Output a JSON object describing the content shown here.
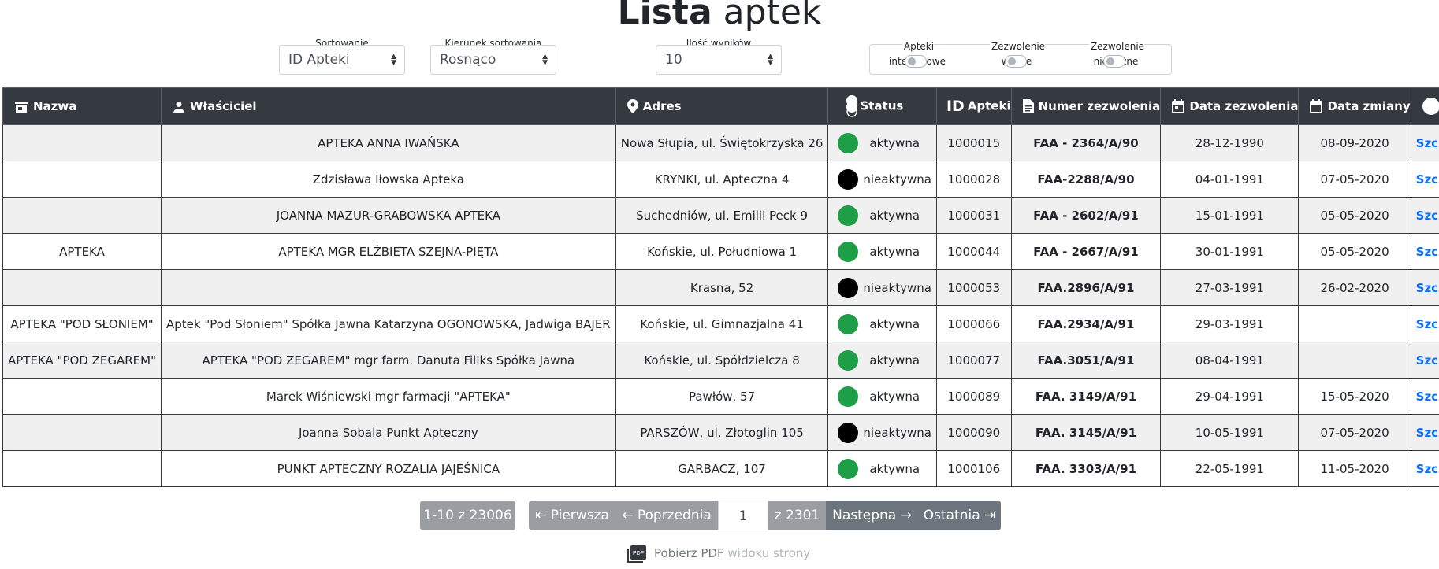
{
  "title": {
    "bold": "Lista",
    "light": "aptek"
  },
  "controls": {
    "sort": {
      "label": "Sortowanie",
      "value": "ID Apteki"
    },
    "direction": {
      "label": "Kierunek sortowania",
      "value": "Rosnąco"
    },
    "count": {
      "label": "Ilość wyników",
      "value": "10"
    }
  },
  "toggles": [
    {
      "label": "Apteki internetowe",
      "on": false
    },
    {
      "label": "Zezwolenie ważne",
      "on": false
    },
    {
      "label": "Zezwolenie nieważne",
      "on": false
    }
  ],
  "columns": [
    "Nazwa",
    "Właściciel",
    "Adres",
    "Status",
    "Apteki",
    "Numer zezwolenia",
    "Data zezwolenia",
    "Data zmiany",
    ""
  ],
  "id_prefix": "ID",
  "status_colors": {
    "aktywna": "#1e9e47",
    "nieaktywna": "#000000"
  },
  "rows": [
    {
      "nazwa": "",
      "wlasciciel": "APTEKA ANNA IWAŃSKA",
      "adres": "Nowa Słupia, ul. Świętokrzyska 26",
      "status": "aktywna",
      "id": "1000015",
      "numer": "FAA - 2364/A/90",
      "data_zezw": "28-12-1990",
      "data_zm": "08-09-2020",
      "link": "Szczegóły"
    },
    {
      "nazwa": "",
      "wlasciciel": "Zdzisława Iłowska Apteka",
      "adres": "KRYNKI, ul. Apteczna 4",
      "status": "nieaktywna",
      "id": "1000028",
      "numer": "FAA-2288/A/90",
      "data_zezw": "04-01-1991",
      "data_zm": "07-05-2020",
      "link": "Szczegóły"
    },
    {
      "nazwa": "",
      "wlasciciel": "JOANNA MAZUR-GRABOWSKA APTEKA",
      "adres": "Suchedniów, ul. Emilii Peck 9",
      "status": "aktywna",
      "id": "1000031",
      "numer": "FAA - 2602/A/91",
      "data_zezw": "15-01-1991",
      "data_zm": "05-05-2020",
      "link": "Szczegóły"
    },
    {
      "nazwa": "APTEKA",
      "wlasciciel": "APTEKA MGR ELŻBIETA SZEJNA-PIĘTA",
      "adres": "Końskie, ul. Południowa 1",
      "status": "aktywna",
      "id": "1000044",
      "numer": "FAA - 2667/A/91",
      "data_zezw": "30-01-1991",
      "data_zm": "05-05-2020",
      "link": "Szczegóły"
    },
    {
      "nazwa": "",
      "wlasciciel": "",
      "adres": "Krasna, 52",
      "status": "nieaktywna",
      "id": "1000053",
      "numer": "FAA.2896/A/91",
      "data_zezw": "27-03-1991",
      "data_zm": "26-02-2020",
      "link": "Szczegóły"
    },
    {
      "nazwa": "APTEKA \"POD SŁONIEM\"",
      "wlasciciel": "Aptek \"Pod Słoniem\" Spółka Jawna Katarzyna OGONOWSKA, Jadwiga BAJER",
      "adres": "Końskie, ul. Gimnazjalna 41",
      "status": "aktywna",
      "id": "1000066",
      "numer": "FAA.2934/A/91",
      "data_zezw": "29-03-1991",
      "data_zm": "",
      "link": "Szczegóły"
    },
    {
      "nazwa": "APTEKA \"POD ZEGAREM\"",
      "wlasciciel": "APTEKA \"POD ZEGAREM\" mgr farm. Danuta Filiks Spółka Jawna",
      "adres": "Końskie, ul. Spółdzielcza 8",
      "status": "aktywna",
      "id": "1000077",
      "numer": "FAA.3051/A/91",
      "data_zezw": "08-04-1991",
      "data_zm": "",
      "link": "Szczegóły"
    },
    {
      "nazwa": "",
      "wlasciciel": "Marek Wiśniewski mgr farmacji \"APTEKA\"",
      "adres": "Pawłów, 57",
      "status": "aktywna",
      "id": "1000089",
      "numer": "FAA. 3149/A/91",
      "data_zezw": "29-04-1991",
      "data_zm": "15-05-2020",
      "link": "Szczegóły"
    },
    {
      "nazwa": "",
      "wlasciciel": "Joanna Sobala Punkt Apteczny",
      "adres": "PARSZÓW, ul. Złotoglin 105",
      "status": "nieaktywna",
      "id": "1000090",
      "numer": "FAA. 3145/A/91",
      "data_zezw": "10-05-1991",
      "data_zm": "07-05-2020",
      "link": "Szczegóły"
    },
    {
      "nazwa": "",
      "wlasciciel": "PUNKT APTECZNY ROZALIA JAJEŚNICA",
      "adres": "GARBACZ, 107",
      "status": "aktywna",
      "id": "1000106",
      "numer": "FAA. 3303/A/91",
      "data_zezw": "22-05-1991",
      "data_zm": "11-05-2020",
      "link": "Szczegóły"
    }
  ],
  "pagination": {
    "range": "1-10 z 23006",
    "first": "⇤ Pierwsza",
    "prev": "← Poprzednia",
    "page": "1",
    "total": "z 2301",
    "next": "Następna →",
    "last": "Ostatnia ⇥"
  },
  "pdf": {
    "strong": "Pobierz PDF",
    "rest": "widoku strony"
  }
}
